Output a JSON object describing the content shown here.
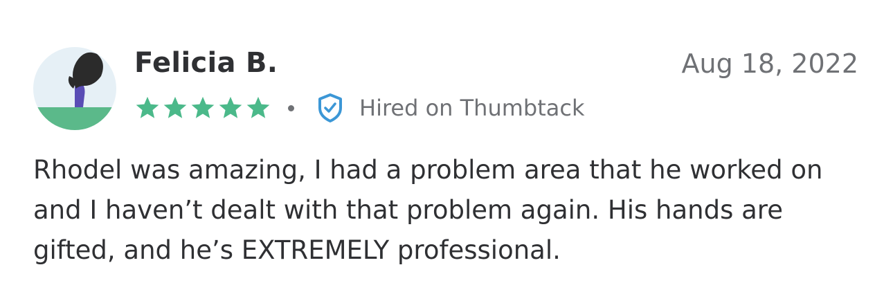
{
  "review": {
    "reviewer_name": "Felicia B.",
    "date": "Aug 18, 2022",
    "rating": 5,
    "rating_max": 5,
    "badge_label": "Hired on Thumbtack",
    "body": "Rhodel was amazing, I had a problem area that he worked on and I haven’t dealt with that problem again. His hands are gifted, and he’s EXTREMELY professional."
  },
  "colors": {
    "star": "#4bb98a",
    "badge": "#3c97d6",
    "text_primary": "#2f3033",
    "text_secondary": "#6f7175",
    "avatar_bg": "#e6f0f6",
    "avatar_ground": "#5bb98a",
    "avatar_figure": "#5a4db5",
    "avatar_hair": "#2b2b2b"
  },
  "icons": {
    "star": "star-icon",
    "badge": "shield-check-icon",
    "avatar": "user-illustration"
  }
}
